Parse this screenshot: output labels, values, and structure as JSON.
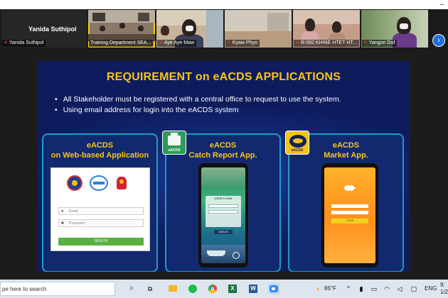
{
  "gallery": {
    "self_name": "Yanida Suthipol",
    "tiles": [
      {
        "label": "Yanida Suthipol",
        "mic_muted": true
      },
      {
        "label": "Training Department SEA...",
        "mic_muted": false
      },
      {
        "label": "Aye Aye Maw",
        "mic_muted": true
      },
      {
        "label": "Kyaw Phyo",
        "mic_muted": true
      },
      {
        "label": "R-092 KHINE HTET HT...",
        "mic_muted": true
      },
      {
        "label": "Yangon Dof",
        "mic_muted": true
      }
    ],
    "next_icon": "chevron-right-icon"
  },
  "slide": {
    "title": "REQUIREMENT on eACDS  APPLICATIONS",
    "bullets": [
      "All Stakeholder must be registered with a central office to request to use the system.",
      "Using email address for login into the eACDS system"
    ],
    "panels": [
      {
        "title_line1": "eACDS",
        "title_line2": "on Web-based Application",
        "login": {
          "email_placeholder": "Email",
          "password_placeholder": "Password",
          "sign_in_label": "SIGN IN"
        }
      },
      {
        "title_line1": "eACDS",
        "title_line2": "Catch Report App.",
        "icon_label": "eACDS",
        "screen": {
          "header": "USER LOGIN",
          "button": "SIGN IN"
        }
      },
      {
        "title_line1": "eACDS",
        "title_line2": "Market App.",
        "icon_label": "eACDS",
        "screen": {
          "button": "LOGIN"
        }
      }
    ],
    "colors": {
      "background": "#0e1c5e",
      "title": "#f7c41a",
      "panel_border": "#1e9cc4"
    }
  },
  "taskbar": {
    "search_placeholder": "pe here to search",
    "weather": "85°F",
    "language": "ENG",
    "time_partial": "9:",
    "date_partial": "1/2"
  }
}
